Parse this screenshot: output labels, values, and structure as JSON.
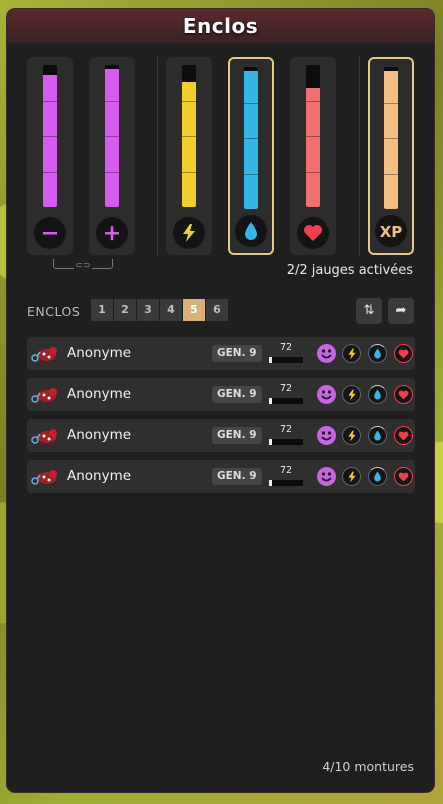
{
  "window": {
    "title": "Enclos"
  },
  "gauges": [
    {
      "name": "minus",
      "color": "#d65cf0",
      "level": 0.93,
      "icon": "minus-icon",
      "selected": false
    },
    {
      "name": "plus",
      "color": "#d65cf0",
      "level": 0.97,
      "icon": "plus-icon",
      "selected": false
    },
    {
      "name": "energy",
      "color": "#f2cd2e",
      "level": 0.88,
      "icon": "lightning-icon",
      "selected": false
    },
    {
      "name": "water",
      "color": "#36b6e8",
      "level": 0.97,
      "icon": "droplet-icon",
      "selected": true
    },
    {
      "name": "love",
      "color": "#f07070",
      "level": 0.84,
      "icon": "heart-icon",
      "selected": false
    },
    {
      "name": "xp",
      "color": "#f2bf80",
      "level": 0.97,
      "icon": "xp-icon",
      "selected": true
    }
  ],
  "gauges_status": "2/2 jauges activées",
  "enclos": {
    "label": "ENCLOS",
    "tabs": [
      "1",
      "2",
      "3",
      "4",
      "5",
      "6"
    ],
    "active_tab": 4
  },
  "mounts": [
    {
      "name": "Anonyme",
      "gen": "GEN. 9",
      "level": "72",
      "xp_fill": 0.08
    },
    {
      "name": "Anonyme",
      "gen": "GEN. 9",
      "level": "72",
      "xp_fill": 0.08
    },
    {
      "name": "Anonyme",
      "gen": "GEN. 9",
      "level": "72",
      "xp_fill": 0.08
    },
    {
      "name": "Anonyme",
      "gen": "GEN. 9",
      "level": "72",
      "xp_fill": 0.08
    }
  ],
  "footer": {
    "count": "4/10 montures"
  }
}
